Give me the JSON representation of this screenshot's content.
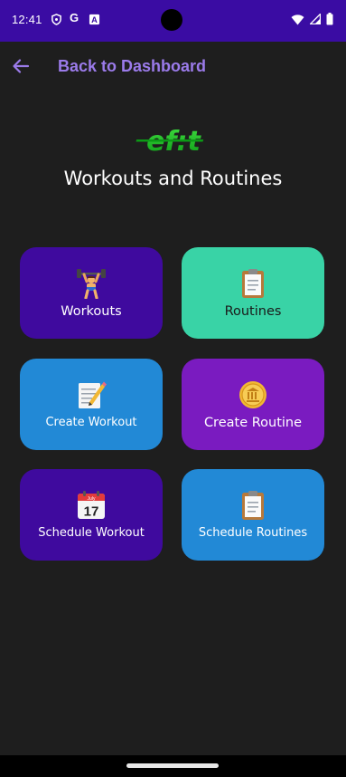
{
  "status_bar": {
    "time": "12:41",
    "left_icons": [
      "shield-icon",
      "google-g-icon",
      "app-a-icon"
    ],
    "right_icons": [
      "wifi-icon",
      "signal-icon",
      "battery-icon"
    ],
    "google_letter": "G",
    "a_letter": "A",
    "bg_color": "#3a0ca3"
  },
  "header": {
    "back_label": "Back to Dashboard",
    "accent_color": "#9b7bea"
  },
  "logo": {
    "text": "ef:t"
  },
  "page": {
    "title": "Workouts and Routines"
  },
  "tiles": [
    {
      "label": "Workouts",
      "icon": "weightlifter-icon",
      "color": "#3f0a9e"
    },
    {
      "label": "Routines",
      "icon": "clipboard-icon",
      "color": "#39d3a6"
    },
    {
      "label": "Create Workout",
      "icon": "memo-icon",
      "color": "#2289d6"
    },
    {
      "label": "Create Routine",
      "icon": "coin-icon",
      "color": "#7a1bc0"
    },
    {
      "label": "Schedule Workout",
      "icon": "calendar-icon",
      "color": "#3f0a9e",
      "calendar_month": "July",
      "calendar_day": "17"
    },
    {
      "label": "Schedule Routines",
      "icon": "clipboard-icon",
      "color": "#2289d6"
    }
  ]
}
